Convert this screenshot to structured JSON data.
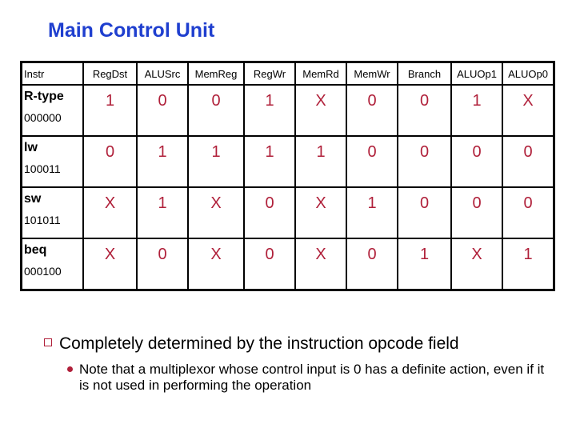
{
  "title": "Main Control Unit",
  "table": {
    "headers": [
      "Instr",
      "RegDst",
      "ALUSrc",
      "MemReg",
      "RegWr",
      "MemRd",
      "MemWr",
      "Branch",
      "ALUOp1",
      "ALUOp0"
    ],
    "rows": [
      {
        "name": "R-type",
        "opcode": "000000",
        "values": [
          "1",
          "0",
          "0",
          "1",
          "X",
          "0",
          "0",
          "1",
          "X"
        ]
      },
      {
        "name": "lw",
        "opcode": "100011",
        "values": [
          "0",
          "1",
          "1",
          "1",
          "1",
          "0",
          "0",
          "0",
          "0"
        ]
      },
      {
        "name": "sw",
        "opcode": "101011",
        "values": [
          "X",
          "1",
          "X",
          "0",
          "X",
          "1",
          "0",
          "0",
          "0"
        ]
      },
      {
        "name": "beq",
        "opcode": "000100",
        "values": [
          "X",
          "0",
          "X",
          "0",
          "X",
          "0",
          "1",
          "X",
          "1"
        ]
      }
    ]
  },
  "bullets": {
    "main": "Completely determined by the instruction opcode field",
    "sub": "Note that a multiplexor whose control input is 0 has a definite action, even if it is not used in performing the operation"
  },
  "colors": {
    "title": "#1f3fcf",
    "value": "#b0203a",
    "bullet": "#b0203a"
  }
}
